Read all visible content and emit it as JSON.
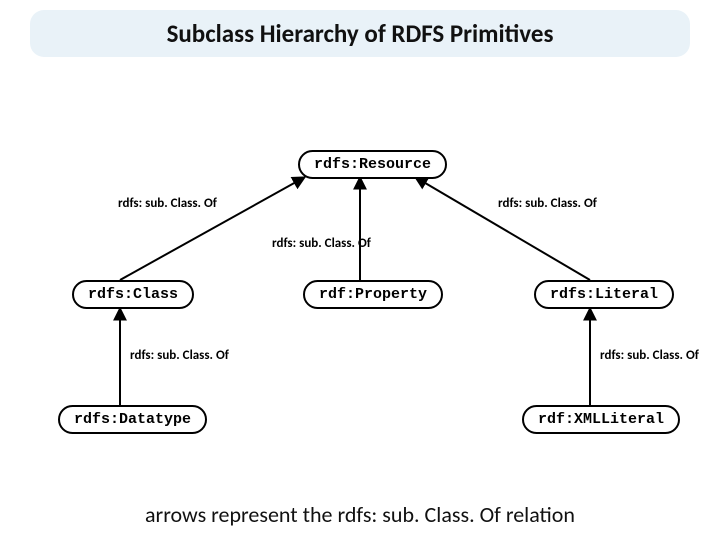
{
  "title": "Subclass Hierarchy of RDFS Primitives",
  "nodes": {
    "resource": "rdfs:Resource",
    "class": "rdfs:Class",
    "property": "rdf:Property",
    "literal": "rdfs:Literal",
    "datatype": "rdfs:Datatype",
    "xmlliteral": "rdf:XMLLiteral"
  },
  "edgeLabel": "rdfs: sub. Class. Of",
  "caption": "arrows represent the rdfs: sub. Class. Of relation",
  "chart_data": {
    "type": "graph",
    "description": "Subclass hierarchy of core RDFS primitives. Directed edges represent rdfs:subClassOf pointing from subclass up to superclass.",
    "nodes": [
      {
        "id": "rdfs:Resource"
      },
      {
        "id": "rdfs:Class"
      },
      {
        "id": "rdf:Property"
      },
      {
        "id": "rdfs:Literal"
      },
      {
        "id": "rdfs:Datatype"
      },
      {
        "id": "rdf:XMLLiteral"
      }
    ],
    "edges": [
      {
        "from": "rdfs:Class",
        "to": "rdfs:Resource",
        "label": "rdfs:subClassOf"
      },
      {
        "from": "rdf:Property",
        "to": "rdfs:Resource",
        "label": "rdfs:subClassOf"
      },
      {
        "from": "rdfs:Literal",
        "to": "rdfs:Resource",
        "label": "rdfs:subClassOf"
      },
      {
        "from": "rdfs:Datatype",
        "to": "rdfs:Class",
        "label": "rdfs:subClassOf"
      },
      {
        "from": "rdf:XMLLiteral",
        "to": "rdfs:Literal",
        "label": "rdfs:subClassOf"
      }
    ]
  }
}
